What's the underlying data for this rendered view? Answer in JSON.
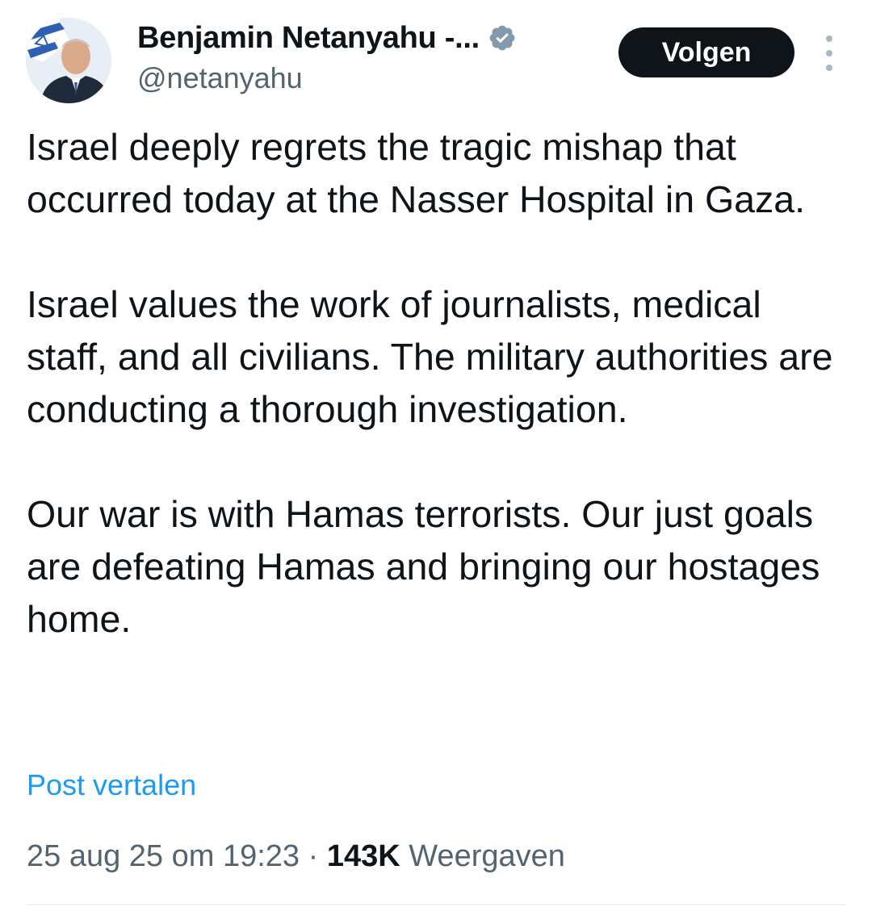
{
  "author": {
    "display_name": "Benjamin Netanyahu -...",
    "handle": "@netanyahu",
    "verified": true,
    "verified_badge_color": "#829aab"
  },
  "actions": {
    "follow_label": "Volgen",
    "more_icon": "more-vertical-icon"
  },
  "tweet": {
    "paragraphs": [
      "Israel deeply regrets the tragic mishap that occurred today at the Nasser Hospital in Gaza.",
      "Israel values the work of journalists, medical staff, and all civilians. The military authorities are conducting a thorough investigation.",
      "Our war is with Hamas terrorists. Our just goals are defeating Hamas and bringing our hostages home."
    ],
    "translate_label": "Post vertalen",
    "timestamp": "25 aug 25 om 19:23",
    "separator": "·",
    "views_count": "143K",
    "views_label": "Weergaven"
  },
  "colors": {
    "text_primary": "#0f1419",
    "text_secondary": "#536471",
    "link": "#1d9bf0",
    "follow_bg": "#0f1419",
    "follow_text": "#ffffff"
  }
}
